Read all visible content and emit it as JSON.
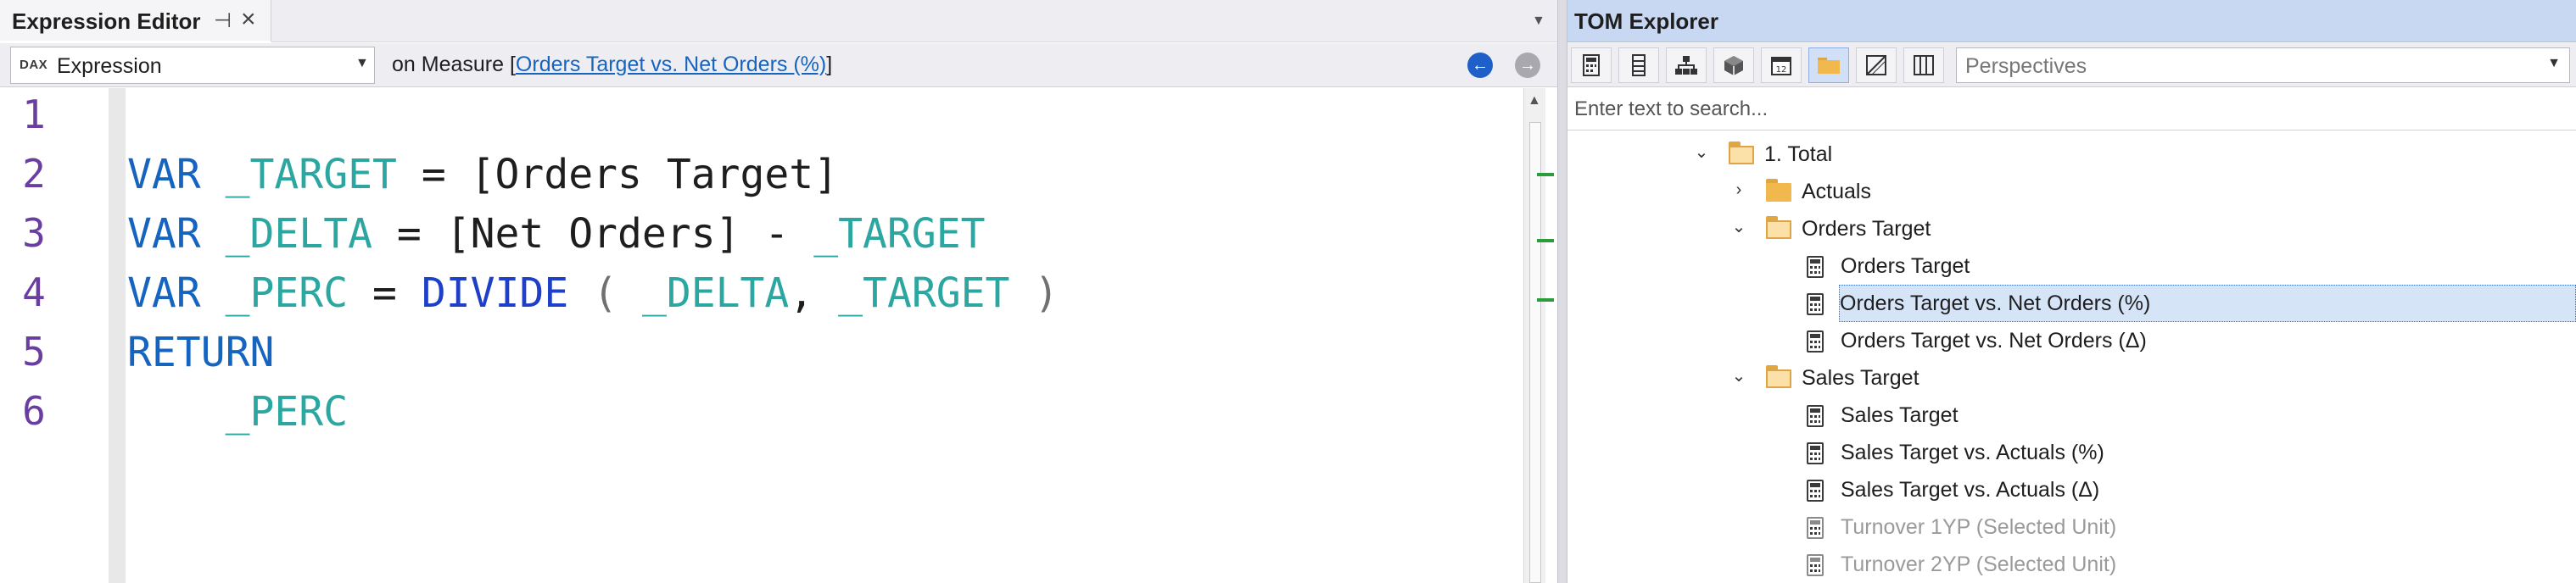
{
  "editor": {
    "title": "Expression Editor",
    "pin_glyph": "⊣",
    "close_glyph": "×",
    "overflow_glyph": "▼",
    "dax_badge": "DAX",
    "expression_select": "Expression",
    "dropdown_glyph": "▼",
    "measure_prefix": "on Measure [",
    "measure_name": "Orders Target vs. Net Orders (%)",
    "measure_suffix": "]",
    "back_glyph": "←",
    "forward_glyph": "→",
    "scroll_up_glyph": "▲",
    "line_numbers": [
      "1",
      "2",
      "3",
      "4",
      "5",
      "6"
    ],
    "code": {
      "l2": {
        "kw": "VAR",
        "var": "_TARGET",
        "eq": "=",
        "rest": "[Orders Target]"
      },
      "l3": {
        "kw": "VAR",
        "var": "_DELTA",
        "eq": "=",
        "rest": "[Net Orders] -",
        "var2": "_TARGET"
      },
      "l4": {
        "kw": "VAR",
        "var": "_PERC",
        "eq": "=",
        "fn": "DIVIDE",
        "open": "(",
        "a1": "_DELTA",
        "comma": ",",
        "a2": "_TARGET",
        "close": ")"
      },
      "l5": {
        "kw": "RETURN"
      },
      "l6": {
        "var": "_PERC"
      }
    }
  },
  "tom": {
    "title": "TOM Explorer",
    "toolbar_icons": [
      "calculator-icon",
      "column-icon",
      "hierarchy-icon",
      "cube-icon",
      "calendar-icon",
      "folder-icon",
      "partition-icon",
      "grid-icon"
    ],
    "perspectives": "Perspectives",
    "dropdown_glyph": "▼",
    "search_placeholder": "Enter text to search...",
    "tree": [
      {
        "label": "1. Total",
        "type": "folder-open",
        "expander": "⌄",
        "level": 0
      },
      {
        "label": "Actuals",
        "type": "folder",
        "expander": "›",
        "level": 1
      },
      {
        "label": "Orders Target",
        "type": "folder-open",
        "expander": "⌄",
        "level": 1
      },
      {
        "label": "Orders Target",
        "type": "measure",
        "level": 2
      },
      {
        "label": "Orders Target vs. Net Orders (%)",
        "type": "measure",
        "level": 2,
        "selected": true
      },
      {
        "label": "Orders Target vs. Net Orders (Δ)",
        "type": "measure",
        "level": 2
      },
      {
        "label": "Sales Target",
        "type": "folder-open",
        "expander": "⌄",
        "level": 1
      },
      {
        "label": "Sales Target",
        "type": "measure",
        "level": 2
      },
      {
        "label": "Sales Target vs. Actuals (%)",
        "type": "measure",
        "level": 2
      },
      {
        "label": "Sales Target vs. Actuals (Δ)",
        "type": "measure",
        "level": 2
      },
      {
        "label": "Turnover 1YP (Selected Unit)",
        "type": "measure",
        "level": 2,
        "dim": true
      },
      {
        "label": "Turnover 2YP (Selected Unit)",
        "type": "measure",
        "level": 2,
        "dim": true
      }
    ]
  },
  "colors": {
    "keyword": "#1565c0",
    "variable": "#2ba6a0",
    "function": "#1e40c8",
    "line_number": "#6a3ea1",
    "tom_header": "#c9d8f2",
    "selection": "#d6e4f8"
  }
}
